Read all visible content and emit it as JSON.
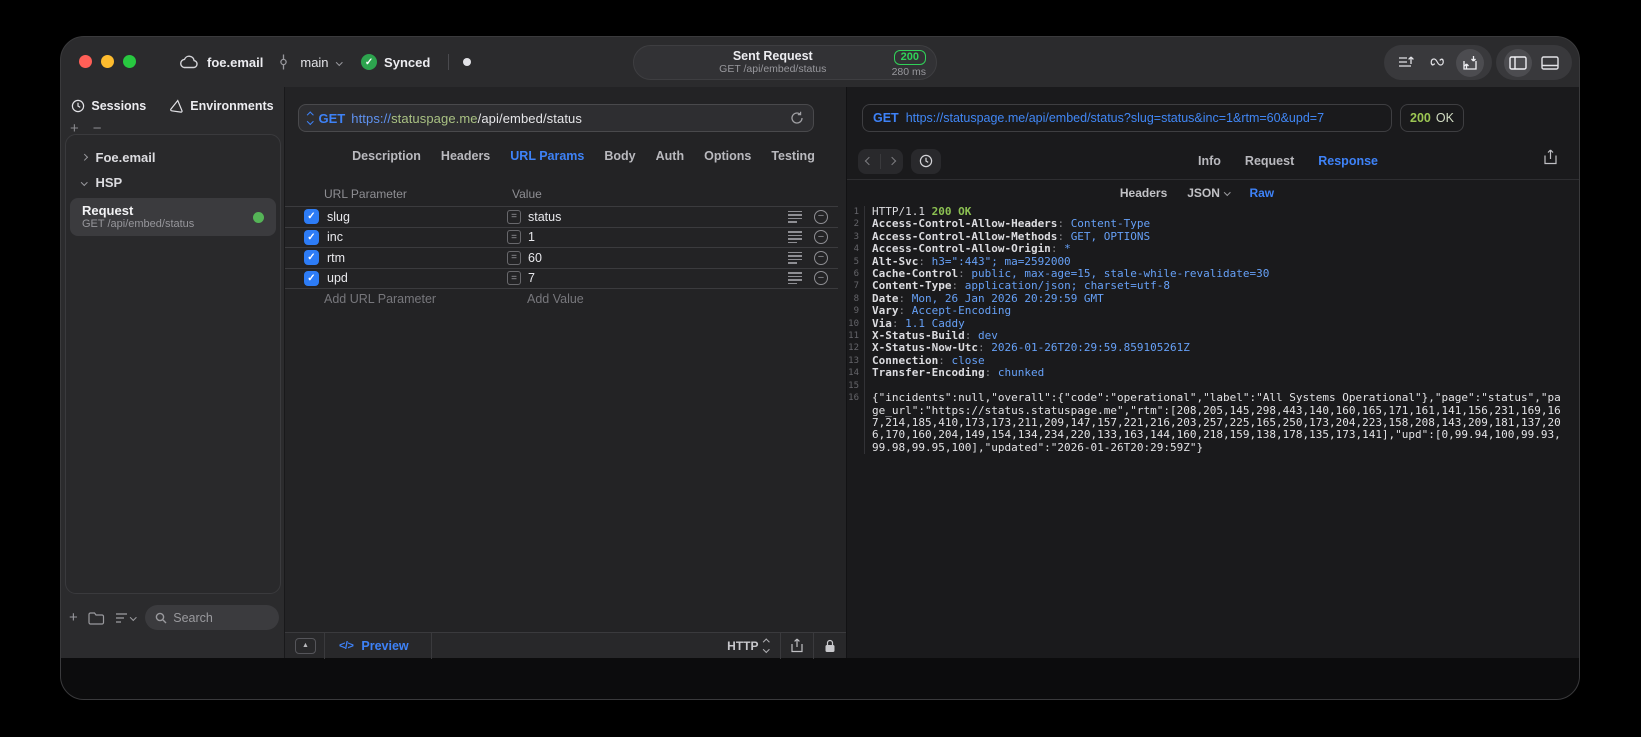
{
  "titlebar": {
    "project": "foe.email",
    "branch": "main",
    "sync_status": "Synced",
    "request_title": "Sent Request",
    "request_subtitle": "GET /api/embed/status",
    "status_code": "200",
    "duration": "280 ms"
  },
  "sidebar": {
    "tabs": [
      {
        "label": "Sessions",
        "icon": "clock-icon"
      },
      {
        "label": "Environments",
        "icon": "environments-icon"
      }
    ],
    "tree": [
      {
        "label": "Foe.email",
        "expanded": false
      },
      {
        "label": "HSP",
        "expanded": true
      }
    ],
    "request_item": {
      "title": "Request",
      "subtitle": "GET /api/embed/status"
    },
    "search_placeholder": "Search"
  },
  "request_panel": {
    "method": "GET",
    "url_scheme": "https://",
    "url_host": "statuspage.me",
    "url_path": "/api/embed/status",
    "tabs": [
      "Description",
      "Headers",
      "URL Params",
      "Body",
      "Auth",
      "Options",
      "Testing"
    ],
    "active_tab": "URL Params",
    "table": {
      "columns": [
        "URL Parameter",
        "Value"
      ],
      "rows": [
        {
          "checked": true,
          "name": "slug",
          "value": "status"
        },
        {
          "checked": true,
          "name": "inc",
          "value": "1"
        },
        {
          "checked": true,
          "name": "rtm",
          "value": "60"
        },
        {
          "checked": true,
          "name": "upd",
          "value": "7"
        }
      ],
      "add_name_placeholder": "Add URL Parameter",
      "add_value_placeholder": "Add Value"
    },
    "footer": {
      "preview_label": "Preview",
      "protocol": "HTTP"
    }
  },
  "response_panel": {
    "method": "GET",
    "url": "https://statuspage.me/api/embed/status?slug=status&inc=1&rtm=60&upd=7",
    "status": "200",
    "status_text": "OK",
    "tabs": [
      "Info",
      "Request",
      "Response"
    ],
    "active_tab": "Response",
    "subtabs": [
      "Headers",
      "JSON",
      "Raw"
    ],
    "active_subtab": "Raw",
    "status_line": {
      "num": 1,
      "version": "HTTP/1.1",
      "status": "200 OK"
    },
    "headers": [
      {
        "num": 2,
        "name": "Access-Control-Allow-Headers",
        "value": "Content-Type"
      },
      {
        "num": 3,
        "name": "Access-Control-Allow-Methods",
        "value": "GET, OPTIONS"
      },
      {
        "num": 4,
        "name": "Access-Control-Allow-Origin",
        "value": "*"
      },
      {
        "num": 5,
        "name": "Alt-Svc",
        "value": "h3=\":443\"; ma=2592000"
      },
      {
        "num": 6,
        "name": "Cache-Control",
        "value": "public, max-age=15, stale-while-revalidate=30"
      },
      {
        "num": 7,
        "name": "Content-Type",
        "value": "application/json; charset=utf-8"
      },
      {
        "num": 8,
        "name": "Date",
        "value": "Mon, 26 Jan 2026 20:29:59 GMT"
      },
      {
        "num": 9,
        "name": "Vary",
        "value": "Accept-Encoding"
      },
      {
        "num": 10,
        "name": "Via",
        "value": "1.1 Caddy"
      },
      {
        "num": 11,
        "name": "X-Status-Build",
        "value": "dev"
      },
      {
        "num": 12,
        "name": "X-Status-Now-Utc",
        "value": "2026-01-26T20:29:59.859105261Z"
      },
      {
        "num": 13,
        "name": "Connection",
        "value": "close"
      },
      {
        "num": 14,
        "name": "Transfer-Encoding",
        "value": "chunked"
      }
    ],
    "blank_line_num": 15,
    "body_line_num": 16,
    "body": "{\"incidents\":null,\"overall\":{\"code\":\"operational\",\"label\":\"All Systems Operational\"},\"page\":\"status\",\"page_url\":\"https://status.statuspage.me\",\"rtm\":[208,205,145,298,443,140,160,165,171,161,141,156,231,169,167,214,185,410,173,173,211,209,147,157,221,216,203,257,225,165,250,173,204,223,158,208,143,209,181,137,206,170,160,204,149,154,134,234,220,133,163,144,160,218,159,138,178,135,173,141],\"upd\":[0,99.94,100,99.93,99.98,99.95,100],\"updated\":\"2026-01-26T20:29:59Z\"}"
  },
  "icons": {
    "check": "✓",
    "minus": "−",
    "plus": "+",
    "equals": "=",
    "collapse": "▲"
  },
  "colors": {
    "accent_blue": "#3e82f7",
    "status_green": "#30d158",
    "code_green": "#8cc152",
    "code_value_blue": "#66a0f6",
    "checkbox_blue": "#2d7cf6",
    "traffic_red": "#ff5f57",
    "traffic_yellow": "#febc2e",
    "traffic_green": "#28c840"
  }
}
